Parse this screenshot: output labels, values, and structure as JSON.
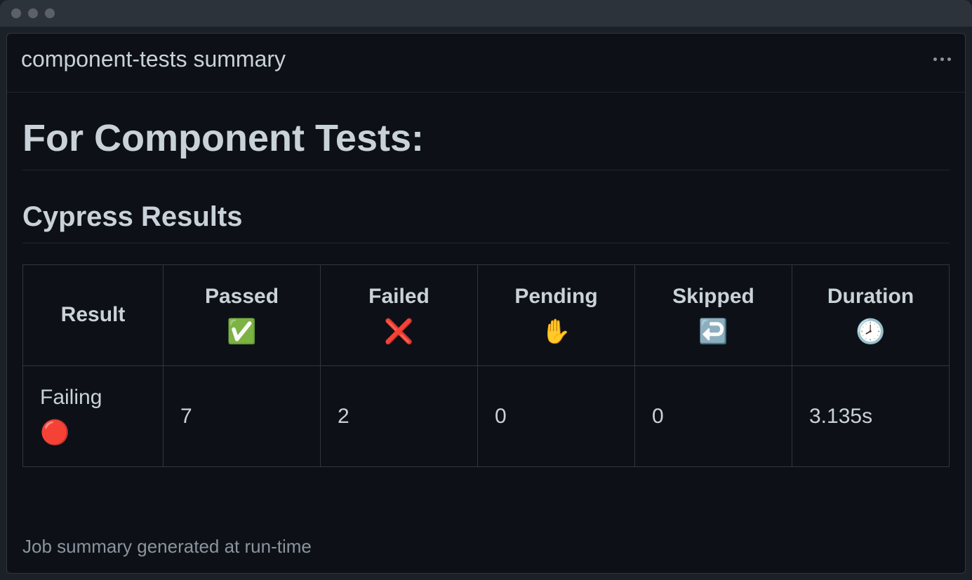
{
  "panel": {
    "title": "component-tests summary"
  },
  "headings": {
    "main": "For Component Tests:",
    "sub": "Cypress Results"
  },
  "table": {
    "headers": {
      "result": "Result",
      "passed": {
        "label": "Passed",
        "icon": "✅"
      },
      "failed": {
        "label": "Failed",
        "icon": "❌"
      },
      "pending": {
        "label": "Pending",
        "icon": "✋"
      },
      "skipped": {
        "label": "Skipped",
        "icon": "↩️"
      },
      "duration": {
        "label": "Duration",
        "icon": "🕗"
      }
    },
    "row": {
      "result": {
        "text": "Failing",
        "icon": "🔴"
      },
      "passed": "7",
      "failed": "2",
      "pending": "0",
      "skipped": "0",
      "duration": "3.135s"
    }
  },
  "footer": "Job summary generated at run-time"
}
